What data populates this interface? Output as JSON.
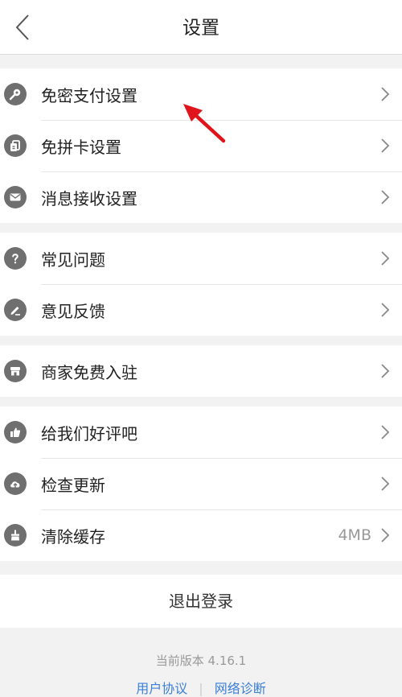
{
  "header": {
    "title": "设置"
  },
  "groups": [
    {
      "items": [
        {
          "label": "免密支付设置",
          "icon": "key-icon"
        },
        {
          "label": "免拼卡设置",
          "icon": "card-icon"
        },
        {
          "label": "消息接收设置",
          "icon": "mail-icon"
        }
      ]
    },
    {
      "items": [
        {
          "label": "常见问题",
          "icon": "question-icon"
        },
        {
          "label": "意见反馈",
          "icon": "pencil-icon"
        }
      ]
    },
    {
      "items": [
        {
          "label": "商家免费入驻",
          "icon": "store-icon"
        }
      ]
    },
    {
      "items": [
        {
          "label": "给我们好评吧",
          "icon": "thumbs-up-icon"
        },
        {
          "label": "检查更新",
          "icon": "cloud-upload-icon"
        },
        {
          "label": "清除缓存",
          "icon": "broom-icon",
          "value": "4MB"
        }
      ]
    }
  ],
  "logout": {
    "label": "退出登录"
  },
  "footer": {
    "version": "当前版本 4.16.1",
    "link_agreement": "用户协议",
    "link_diagnosis": "网络诊断"
  },
  "colors": {
    "icon_bg": "#6f6f6f",
    "link": "#3b7fd8",
    "annotation_arrow": "#e0141b"
  }
}
